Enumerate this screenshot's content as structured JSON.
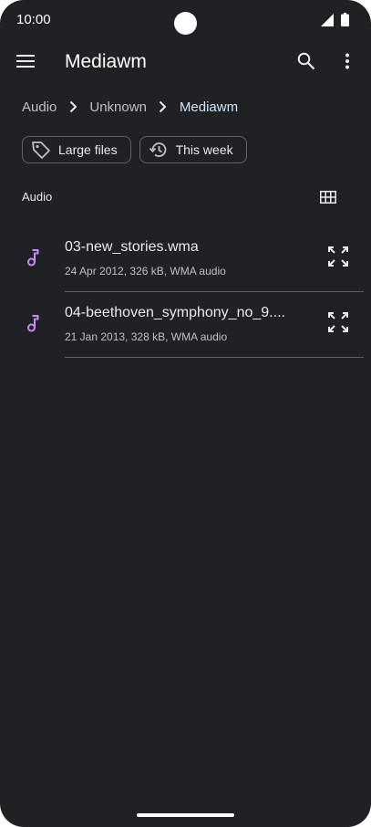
{
  "status_bar": {
    "time": "10:00",
    "icons": [
      "signal-icon",
      "battery-icon"
    ]
  },
  "app_bar": {
    "title": "Mediawm",
    "icons": [
      "menu-icon",
      "search-icon",
      "more-vert-icon"
    ]
  },
  "breadcrumb": {
    "items": [
      "Audio",
      "Unknown",
      "Mediawm"
    ],
    "separator_icon": "chevron-right-icon"
  },
  "filters": [
    {
      "label": "Large files",
      "icon": "label-tag-icon"
    },
    {
      "label": "This week",
      "icon": "history-icon"
    }
  ],
  "section": {
    "title": "Audio",
    "view_toggle_icon": "grid-view-icon"
  },
  "files": [
    {
      "name": "03-new_stories.wma",
      "meta": "24 Apr 2012, 326 kB, WMA audio",
      "icon": "music-note-icon",
      "action_icon": "expand-icon"
    },
    {
      "name": "04-beethoven_symphony_no_9....",
      "meta": "21 Jan 2013, 328 kB, WMA audio",
      "icon": "music-note-icon",
      "action_icon": "expand-icon"
    }
  ],
  "colors": {
    "background": "#202124",
    "accent_music": "#c58af9",
    "text_primary": "#e8eaed",
    "text_secondary": "#bdc1c6",
    "breadcrumb_current": "#d2e3fc",
    "outline": "#5f6368"
  }
}
